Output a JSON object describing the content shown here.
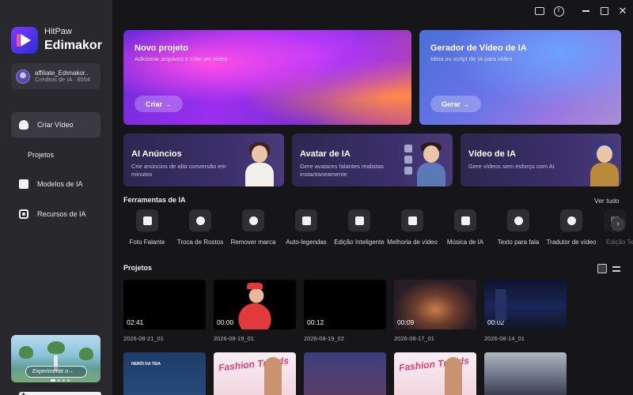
{
  "app": {
    "brand_top": "HitPaw",
    "brand_name": "Edimakor"
  },
  "user": {
    "name": "affiliate_Edimakor..",
    "credits": "Créditos de IA : 8554"
  },
  "sidebar": {
    "items": [
      {
        "label": "Criar Vídeo",
        "icon": "video-icon",
        "active": true
      },
      {
        "label": "Projetos",
        "icon": "folder-icon",
        "active": false
      },
      {
        "label": "Modelos de IA",
        "icon": "template-icon",
        "active": false
      },
      {
        "label": "Recursos de IA",
        "icon": "resources-icon",
        "active": false
      }
    ],
    "promo_button": "Experimente o→"
  },
  "hero": {
    "new_project": {
      "title": "Novo projeto",
      "subtitle": "Adicionar arquivos e criar um vídeo",
      "button": "Criar →"
    },
    "generator": {
      "title": "Gerador de Vídeo de IA",
      "subtitle": "Ideia ou script de IA para vídeo",
      "button": "Gerar →"
    }
  },
  "features": [
    {
      "title": "AI Anúncios",
      "subtitle": "Crie anúncios de alta conversão em minutos"
    },
    {
      "title": "Avatar de IA",
      "subtitle": "Gere avatares falantes realistas instantaneamente"
    },
    {
      "title": "Vídeo de IA",
      "subtitle": "Gere vídeos sem esforço com AI"
    }
  ],
  "tools_section": {
    "title": "Ferramentas de IA",
    "see_all": "Ver tudo",
    "tools": [
      {
        "label": "Foto Falante",
        "icon": "talking-photo-icon"
      },
      {
        "label": "Troca de Rostos",
        "icon": "face-swap-icon"
      },
      {
        "label": "Remover marca",
        "icon": "watermark-remove-icon"
      },
      {
        "label": "Auto-legendas",
        "icon": "captions-icon"
      },
      {
        "label": "Edição Inteligente",
        "icon": "smart-edit-icon"
      },
      {
        "label": "Melhoria de vídeo",
        "icon": "video-enhance-icon"
      },
      {
        "label": "Música de IA",
        "icon": "music-icon"
      },
      {
        "label": "Texto para fala",
        "icon": "tts-icon"
      },
      {
        "label": "Tradutor de vídeo",
        "icon": "translate-icon"
      },
      {
        "label": "Edição Te",
        "icon": "text-edit-icon"
      }
    ]
  },
  "projects_section": {
    "title": "Projetos",
    "items": [
      {
        "duration": "02:41",
        "date": "2026-08-21_01"
      },
      {
        "duration": "00:00",
        "date": "2026-08-19_01"
      },
      {
        "duration": "00:12",
        "date": "2026-08-19_02"
      },
      {
        "duration": "00:09",
        "date": "2026-08-17_01"
      },
      {
        "duration": "00:02",
        "date": "2026-08-14_01"
      }
    ],
    "row2": {
      "thumb_label": "HERÓI DA TEIA",
      "fashion_text": "Fashion Trends"
    }
  }
}
